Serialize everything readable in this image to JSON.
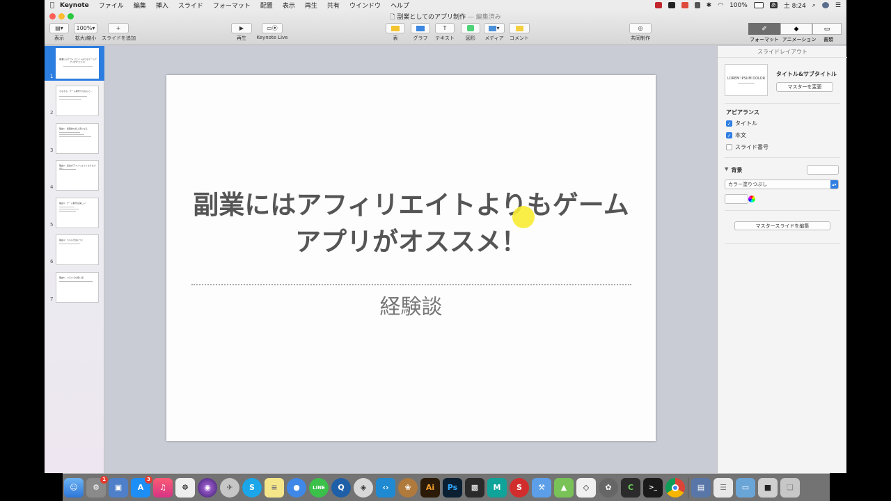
{
  "menubar": {
    "app_name": "Keynote",
    "items": [
      "ファイル",
      "編集",
      "挿入",
      "スライド",
      "フォーマット",
      "配置",
      "表示",
      "再生",
      "共有",
      "ウインドウ",
      "ヘルプ"
    ],
    "battery": "100%",
    "input_mode": "あ",
    "clock": "土 8:24"
  },
  "window": {
    "title": "副業としてのアプリ制作",
    "status": "— 編集済み"
  },
  "toolbar": {
    "view_label": "表示",
    "zoom_value": "100%",
    "zoom_label": "拡大/縮小",
    "add_slide_label": "スライドを追加",
    "play_label": "再生",
    "keynote_live_label": "Keynote Live",
    "table_label": "表",
    "chart_label": "グラフ",
    "text_label": "テキスト",
    "shape_label": "図形",
    "media_label": "メディア",
    "comment_label": "コメント",
    "collab_label": "共同制作",
    "format_label": "フォーマット",
    "animate_label": "アニメーション",
    "document_label": "書類"
  },
  "navigator": {
    "slides": [
      {
        "num": "1",
        "title": "副業にはアフィリエイトよりもゲームアプリがオススメ！"
      },
      {
        "num": "2",
        "title": "そもそも、ゲーム制作するなんて…"
      },
      {
        "num": "3",
        "title": "理由1：長期的な収入源になる"
      },
      {
        "num": "4",
        "title": "理由2：競合がアフィリエイトよりも少ない"
      },
      {
        "num": "5",
        "title": "理由3：ゲーム制作は楽しい"
      },
      {
        "num": "6",
        "title": "理由4：スキルが身につく"
      },
      {
        "num": "7",
        "title": "理由5：いろいろな使い道"
      }
    ]
  },
  "slide": {
    "title": "副業にはアフィリエイトよりもゲームアプリがオススメ！",
    "subtitle": "経験談"
  },
  "inspector": {
    "header": "スライドレイアウト",
    "layout_preview": "LOREM IPSUM DOLOR",
    "layout_name": "タイトル&サブタイトル",
    "change_master": "マスターを変更",
    "appearance_label": "アピアランス",
    "title_cb": "タイトル",
    "body_cb": "本文",
    "slide_number_cb": "スライド番号",
    "background_label": "背景",
    "fill_type": "カラー塗りつぶし",
    "edit_master": "マスタースライドを編集"
  },
  "dock": {
    "system_prefs_badge": "1",
    "app_store_badge": "3",
    "illustrator_label": "Ai",
    "photoshop_label": "Ps"
  },
  "colors": {
    "accent_blue": "#2c7de0",
    "canvas_bg": "#c9ccd5",
    "slide_title": "#555555",
    "cursor_highlight": "#f8ec34"
  }
}
